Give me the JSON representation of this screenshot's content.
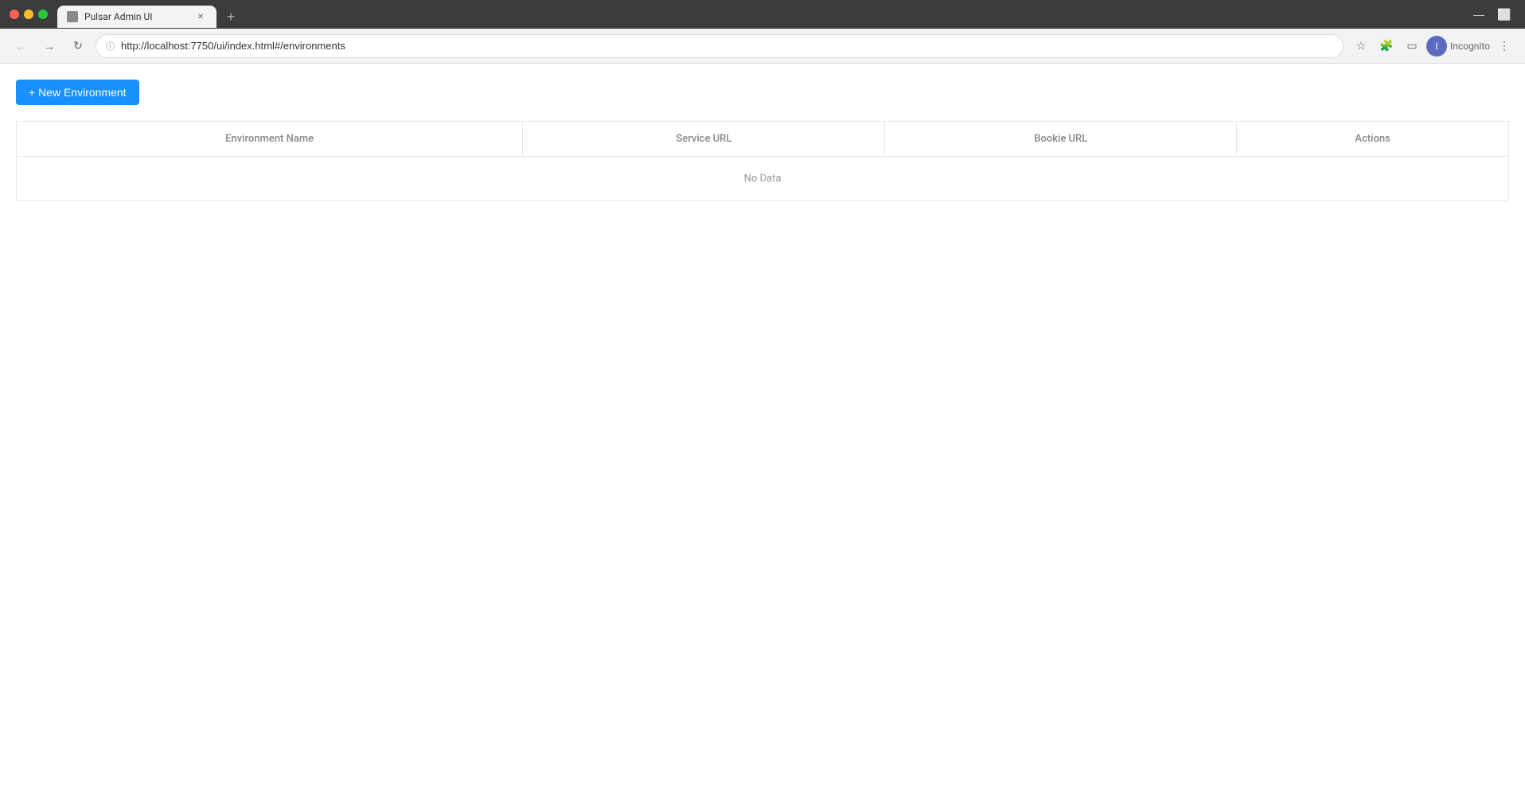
{
  "browser": {
    "tab_title": "Pulsar Admin UI",
    "url": "http://localhost:7750/ui/index.html#/environments",
    "incognito_label": "Incognito",
    "new_tab_label": "+"
  },
  "toolbar": {
    "new_env_btn_label": "+ New Environment",
    "new_env_btn_icon": "+"
  },
  "table": {
    "columns": [
      {
        "key": "env_name",
        "label": "Environment Name"
      },
      {
        "key": "service_url",
        "label": "Service URL"
      },
      {
        "key": "bookie_url",
        "label": "Bookie URL"
      },
      {
        "key": "actions",
        "label": "Actions"
      }
    ],
    "empty_text": "No Data"
  }
}
